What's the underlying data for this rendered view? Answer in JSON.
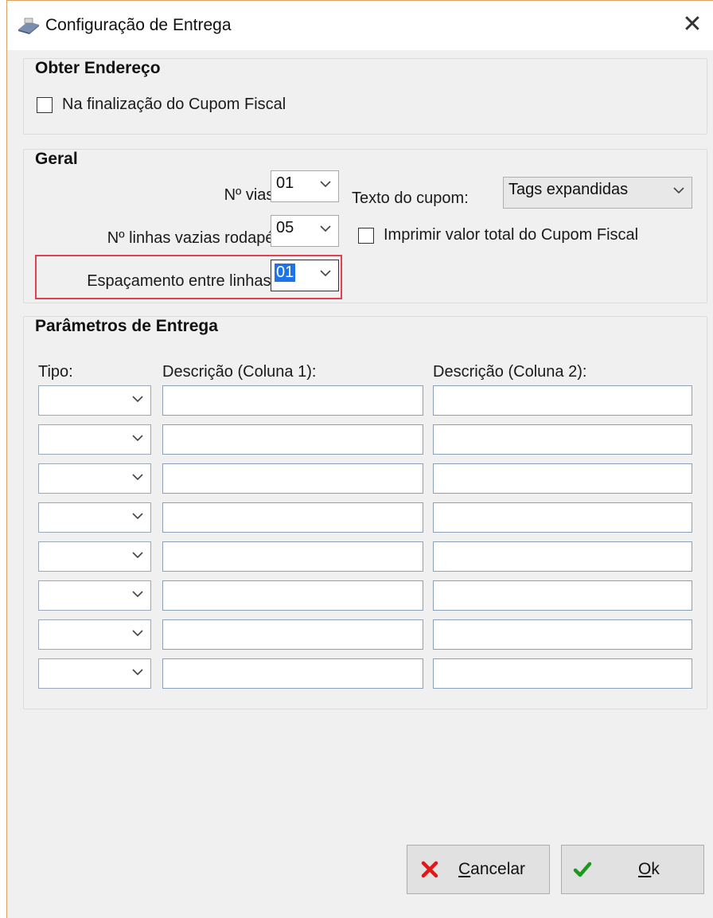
{
  "window": {
    "title": "Configuração de Entrega",
    "close_glyph": "✕"
  },
  "obter_endereco": {
    "title": "Obter Endereço",
    "checkbox_label": "Na finalização do Cupom Fiscal",
    "checked": false
  },
  "geral": {
    "title": "Geral",
    "n_vias_label": "Nº vias:",
    "n_vias_value": "01",
    "n_linhas_label": "Nº linhas vazias rodapé:",
    "n_linhas_value": "05",
    "espacamento_label": "Espaçamento entre linhas:",
    "espacamento_value": "01",
    "texto_cupom_label": "Texto do cupom:",
    "texto_cupom_value": "Tags expandidas",
    "imprimir_label": "Imprimir valor total do Cupom Fiscal",
    "imprimir_checked": false
  },
  "parametros": {
    "title": "Parâmetros de Entrega",
    "col_tipo": "Tipo:",
    "col_desc1": "Descrição (Coluna 1):",
    "col_desc2": "Descrição (Coluna 2):",
    "rows": [
      {
        "tipo": "",
        "desc1": "",
        "desc2": ""
      },
      {
        "tipo": "",
        "desc1": "",
        "desc2": ""
      },
      {
        "tipo": "",
        "desc1": "",
        "desc2": ""
      },
      {
        "tipo": "",
        "desc1": "",
        "desc2": ""
      },
      {
        "tipo": "",
        "desc1": "",
        "desc2": ""
      },
      {
        "tipo": "",
        "desc1": "",
        "desc2": ""
      },
      {
        "tipo": "",
        "desc1": "",
        "desc2": ""
      },
      {
        "tipo": "",
        "desc1": "",
        "desc2": ""
      }
    ]
  },
  "buttons": {
    "cancel_label": "Cancelar",
    "ok_label": "Ok"
  },
  "colors": {
    "highlight": "#e04050",
    "cancel_icon": "#e01818",
    "ok_icon": "#1a9a1a",
    "selection": "#1e73e8"
  }
}
